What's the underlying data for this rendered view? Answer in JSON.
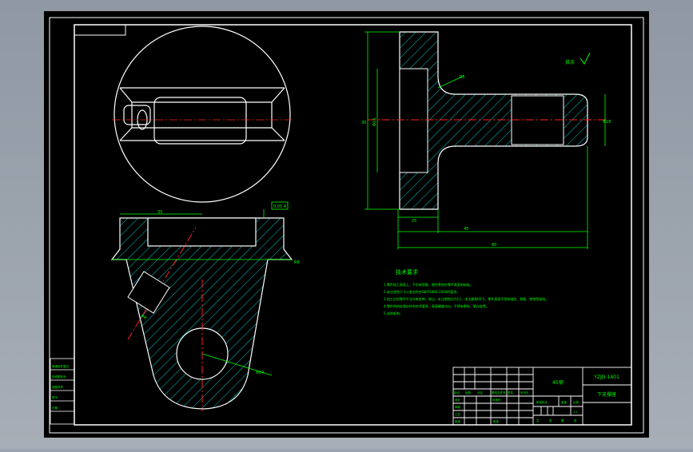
{
  "colors": {
    "background": "#000000",
    "frame": "#ffffff",
    "text": "#00ff00",
    "hatch": "#00c8c8",
    "centerline": "#ff2020",
    "dimension": "#00ff00"
  },
  "tech_requirements": {
    "title": "技术要求",
    "items": [
      "1.零件加工表面上，不应有划痕、擦伤等损伤零件表面的缺陷。",
      "2.未注线性尺寸公差应符合GB/T1804-2000的要求。",
      "3.加工后的零件不允许有毛刺、锐边，未注倒角均为C1，未注圆角R0.5，零件表面不得有碰伤、划痕、锈蚀等缺陷。",
      "4.零件的热处理应符合技术要求，表面硬度均匀，不得有裂纹、氧化皮等。",
      "5.去除毛刺。"
    ]
  },
  "roughness_note": "其余",
  "title_block": {
    "material": "45钢",
    "drawing_no": "YZJD-1401",
    "part_name": "下支撑座",
    "header_row": [
      "标记",
      "处数",
      "分区",
      "更改文件号",
      "签名",
      "年月日"
    ],
    "left_labels": [
      "设计",
      "审核",
      "工艺",
      "批准"
    ],
    "mid_labels": [
      "标准化",
      "批准"
    ],
    "stage_labels": [
      "阶段标记",
      "重量",
      "比例"
    ],
    "scale": "1:1",
    "sheet_row": [
      "共",
      "张",
      "第",
      "张"
    ]
  },
  "side_table": [
    "借通用件登记",
    "旧底图总号",
    "底图总号",
    "签字",
    "日期"
  ],
  "dimensions": {
    "d1": "Φ8",
    "d2": "Φ16",
    "d3": "R5",
    "d4": "25",
    "d5": "45",
    "d6": "80",
    "d7": "30",
    "d8": "Φ24",
    "d9": "R8",
    "d10": "35",
    "d11": "0.05 A",
    "d12": "Φ18"
  }
}
